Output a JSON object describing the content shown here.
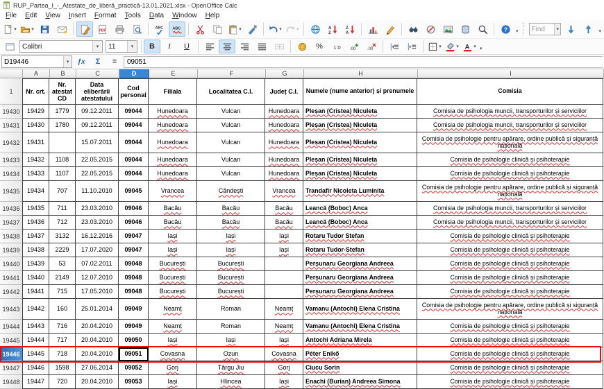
{
  "window": {
    "title": "RUP_Partea_I_-_Atestate_de_liberă_practică-13.01.2021.xlsx - OpenOffice Calc"
  },
  "menu": {
    "items": [
      "File",
      "Edit",
      "View",
      "Insert",
      "Format",
      "Tools",
      "Data",
      "Window",
      "Help"
    ]
  },
  "standard_toolbar": [
    {
      "name": "new-document",
      "dropdown": true
    },
    {
      "name": "open",
      "dropdown": true
    },
    {
      "name": "save"
    },
    {
      "name": "email-document"
    },
    {
      "sep": true
    },
    {
      "name": "edit-mode",
      "active": true
    },
    {
      "name": "export-pdf"
    },
    {
      "name": "print"
    },
    {
      "name": "page-preview"
    },
    {
      "sep": true
    },
    {
      "name": "spellcheck"
    },
    {
      "name": "auto-spellcheck",
      "active": true
    },
    {
      "sep": true
    },
    {
      "name": "cut"
    },
    {
      "name": "copy"
    },
    {
      "name": "paste",
      "dropdown": true
    },
    {
      "name": "format-paintbrush"
    },
    {
      "sep": true
    },
    {
      "name": "undo",
      "dropdown": true
    },
    {
      "name": "redo",
      "dropdown": true,
      "disabled": true
    },
    {
      "sep": true
    },
    {
      "name": "hyperlink"
    },
    {
      "name": "sort-ascending"
    },
    {
      "name": "sort-descending"
    },
    {
      "sep": true
    },
    {
      "name": "chart"
    },
    {
      "name": "draw-functions"
    },
    {
      "sep": true
    },
    {
      "name": "find-replace"
    },
    {
      "name": "navigator"
    },
    {
      "name": "gallery"
    },
    {
      "name": "data-sources"
    },
    {
      "name": "zoom"
    },
    {
      "sep": true
    },
    {
      "name": "help"
    },
    {
      "overflow": true
    },
    {
      "sep": true,
      "dotted": true
    }
  ],
  "find_toolbar": {
    "value": "Find",
    "buttons": [
      {
        "name": "find-next"
      },
      {
        "name": "find-previous"
      },
      {
        "overflow": true
      }
    ]
  },
  "formatting_toolbar": {
    "font_name": "Calibri",
    "font_size": "11",
    "buttons": [
      {
        "name": "bold",
        "text": "B",
        "cls": "b-bold",
        "active": true
      },
      {
        "name": "italic",
        "text": "I",
        "cls": "b-italic"
      },
      {
        "name": "underline",
        "text": "U",
        "cls": "b-underline"
      },
      {
        "sep": true
      },
      {
        "name": "align-left"
      },
      {
        "name": "align-center",
        "active": true
      },
      {
        "name": "align-right"
      },
      {
        "name": "justified"
      },
      {
        "name": "merge-cells",
        "disabled": true
      },
      {
        "sep": true
      },
      {
        "name": "currency-format"
      },
      {
        "name": "percent-format",
        "text": "%"
      },
      {
        "name": "standard-number-format"
      },
      {
        "name": "add-decimal"
      },
      {
        "name": "delete-decimal"
      },
      {
        "sep": true
      },
      {
        "name": "decrease-indent"
      },
      {
        "name": "increase-indent"
      },
      {
        "sep": true
      },
      {
        "name": "borders",
        "dropdown": true
      },
      {
        "name": "background-color",
        "dropdown": true
      },
      {
        "name": "font-color",
        "dropdown": true
      },
      {
        "overflow": true
      }
    ]
  },
  "formula_bar": {
    "cell_reference": "D19446",
    "buttons": [
      {
        "name": "function-wizard",
        "text": "ƒx",
        "cls": "b-fx"
      },
      {
        "name": "sum",
        "text": "Σ",
        "cls": "b-sum"
      },
      {
        "name": "function",
        "text": "=",
        "cls": "b-eq"
      }
    ],
    "input_value": "09051"
  },
  "sheet": {
    "columns": [
      "A",
      "B",
      "C",
      "D",
      "E",
      "F",
      "G",
      "H",
      "I"
    ],
    "selected_column": "D",
    "selected_row": "19446",
    "selected_cell": {
      "reference": "D19446",
      "value": "09051"
    },
    "header_row": {
      "number": "1",
      "cells": [
        "Nr. crt.",
        "Nr. atestat CD",
        "Data eliberării atestatului",
        "Cod personal",
        "Filiala",
        "Localitatea C.I.",
        "Județ C.I.",
        "Numele (nume anterior) și prenumele",
        "Comisia"
      ]
    },
    "rows": [
      {
        "n": "19430",
        "a": "19429",
        "b": "1779",
        "c": "09.12.2011",
        "d": "09044",
        "e": "Hunedoara",
        "f": "Vulcan",
        "f_sq": false,
        "g": "Hunedoara",
        "h": "Pleșan (Cristea) Niculeta",
        "i": "Comisia de psihologia muncii, transporturilor și serviciilor",
        "tall": false
      },
      {
        "n": "19431",
        "a": "19430",
        "b": "1780",
        "c": "09.12.2011",
        "d": "09044",
        "e": "Hunedoara",
        "f": "Vulcan",
        "f_sq": false,
        "g": "Hunedoara",
        "h": "Pleșan (Cristea) Niculeta",
        "i": "Comisia de psihologia muncii, transporturilor și serviciilor",
        "tall": false
      },
      {
        "n": "19432",
        "a": "19431",
        "b": "",
        "c": "15.07.2011",
        "d": "09044",
        "e": "Hunedoara",
        "f": "Vulcan",
        "f_sq": false,
        "g": "Hunedoara",
        "h": "Pleșan (Cristea) Niculeta",
        "i": "Comisia de psihologie pentru apărare, ordine publică și siguranță națională",
        "tall": true
      },
      {
        "n": "19433",
        "a": "19432",
        "b": "1108",
        "c": "22.05.2015",
        "d": "09044",
        "e": "Hunedoara",
        "f": "Vulcan",
        "f_sq": false,
        "g": "Hunedoara",
        "h": "Pleșan (Cristea) Niculeta",
        "i": "Comisia de psihologie clinică și psihoterapie",
        "tall": false
      },
      {
        "n": "19434",
        "a": "19433",
        "b": "1107",
        "c": "22.05.2015",
        "d": "09044",
        "e": "Hunedoara",
        "f": "Vulcan",
        "f_sq": false,
        "g": "Hunedoara",
        "h": "Pleșan (Cristea) Niculeta",
        "i": "Comisia de psihologie clinică și psihoterapie",
        "tall": false
      },
      {
        "n": "19435",
        "a": "19434",
        "b": "707",
        "c": "11.10.2010",
        "d": "09045",
        "e": "Vrancea",
        "f": "Cândești",
        "f_sq": true,
        "g": "Vrancea",
        "h": "Trandafir Nicoleta Luminita",
        "i": "Comisia de psihologie pentru apărare, ordine publică și siguranță națională",
        "tall": true
      },
      {
        "n": "19436",
        "a": "19435",
        "b": "711",
        "c": "23.03.2010",
        "d": "09046",
        "e": "Bacău",
        "f": "Bacău",
        "f_sq": true,
        "g": "Bacău",
        "h": "Leancă (Boboc) Anca",
        "i": "Comisia de psihologia muncii, transporturilor și serviciilor",
        "tall": false
      },
      {
        "n": "19437",
        "a": "19436",
        "b": "712",
        "c": "23.03.2010",
        "d": "09046",
        "e": "Bacău",
        "f": "Bacău",
        "f_sq": true,
        "g": "Bacău",
        "h": "Leancă (Boboc) Anca",
        "i": "Comisia de psihologia muncii, transporturilor și serviciilor",
        "tall": false
      },
      {
        "n": "19438",
        "a": "19437",
        "b": "3132",
        "c": "16.12.2016",
        "d": "09047",
        "e": "Iași",
        "f": "Iași",
        "f_sq": true,
        "g": "Iași",
        "h": "Rotaru Tudor Stefan",
        "i": "Comisia de psihologie clinică și psihoterapie",
        "tall": false
      },
      {
        "n": "19439",
        "a": "19438",
        "b": "2229",
        "c": "17.07.2020",
        "d": "09047",
        "e": "Iași",
        "f": "Iași",
        "f_sq": true,
        "g": "Iași",
        "h": "Rotaru Tudor-Stefan",
        "i": "Comisia de psihologie clinică și psihoterapie",
        "tall": false
      },
      {
        "n": "19440",
        "a": "19439",
        "b": "53",
        "c": "07.02.2011",
        "d": "09048",
        "e": "București",
        "f": "București",
        "f_sq": true,
        "g": "",
        "h": "Perșunaru Georgiana Andreea",
        "i": "Comisia de psihologie clinică și psihoterapie",
        "tall": false
      },
      {
        "n": "19441",
        "a": "19440",
        "b": "2149",
        "c": "12.07.2010",
        "d": "09048",
        "e": "București",
        "f": "București",
        "f_sq": true,
        "g": "",
        "h": "Perșunaru Georgiana Andreea",
        "i": "Comisia de psihologie clinică și psihoterapie",
        "tall": false
      },
      {
        "n": "19442",
        "a": "19441",
        "b": "715",
        "c": "17.05.2010",
        "d": "09048",
        "e": "București",
        "f": "București",
        "f_sq": true,
        "g": "",
        "h": "Perșunaru Georgiana Andreea",
        "i": "Comisia de psihologie clinică și psihoterapie",
        "tall": false
      },
      {
        "n": "19443",
        "a": "19442",
        "b": "160",
        "c": "25.01.2014",
        "d": "09049",
        "e": "Neamț",
        "f": "Roman",
        "f_sq": false,
        "g": "Neamț",
        "h": "Vamanu (Antochi) Elena Cristina",
        "i": "Comisia de psihologie pentru apărare, ordine publică și siguranță națională",
        "tall": true
      },
      {
        "n": "19444",
        "a": "19443",
        "b": "716",
        "c": "20.04.2010",
        "d": "09049",
        "e": "Neamț",
        "f": "Roman",
        "f_sq": false,
        "g": "Neamț",
        "h": "Vamanu (Antochi) Elena Cristina",
        "i": "Comisia de psihologie clinică și psihoterapie",
        "tall": false
      },
      {
        "n": "19445",
        "a": "19444",
        "b": "717",
        "c": "20.04.2010",
        "d": "09050",
        "e": "Iași",
        "f": "Iași",
        "f_sq": true,
        "g": "Iași",
        "h": "Antochi Adriana Mirela",
        "i": "Comisia de psihologie clinică și psihoterapie",
        "tall": false
      },
      {
        "n": "19446",
        "a": "19445",
        "b": "718",
        "c": "20.04.2010",
        "d": "09051",
        "e": "Covasna",
        "f": "Ozun",
        "f_sq": true,
        "g": "Covasna",
        "h": "Péter Enikő",
        "i": "Comisia de psihologie clinică și psihoterapie",
        "tall": false,
        "selected": true
      },
      {
        "n": "19447",
        "a": "19446",
        "b": "1598",
        "c": "27.06.2014",
        "d": "09052",
        "e": "Gorj",
        "f": "Târgu Jiu",
        "f_sq": true,
        "g": "Gorj",
        "h": "Ciucu Sorin",
        "i": "Comisia de psihologie clinică și psihoterapie",
        "tall": false
      },
      {
        "n": "19448",
        "a": "19447",
        "b": "720",
        "c": "20.04.2010",
        "d": "09053",
        "e": "Iași",
        "f": "Hlincea",
        "f_sq": true,
        "g": "Iași",
        "h": "Enachi (Burian) Andreea Simona",
        "i": "Comisia de psihologie clinică și psihoterapie",
        "tall": false
      }
    ],
    "annotation_color": "#ea0b0b"
  }
}
